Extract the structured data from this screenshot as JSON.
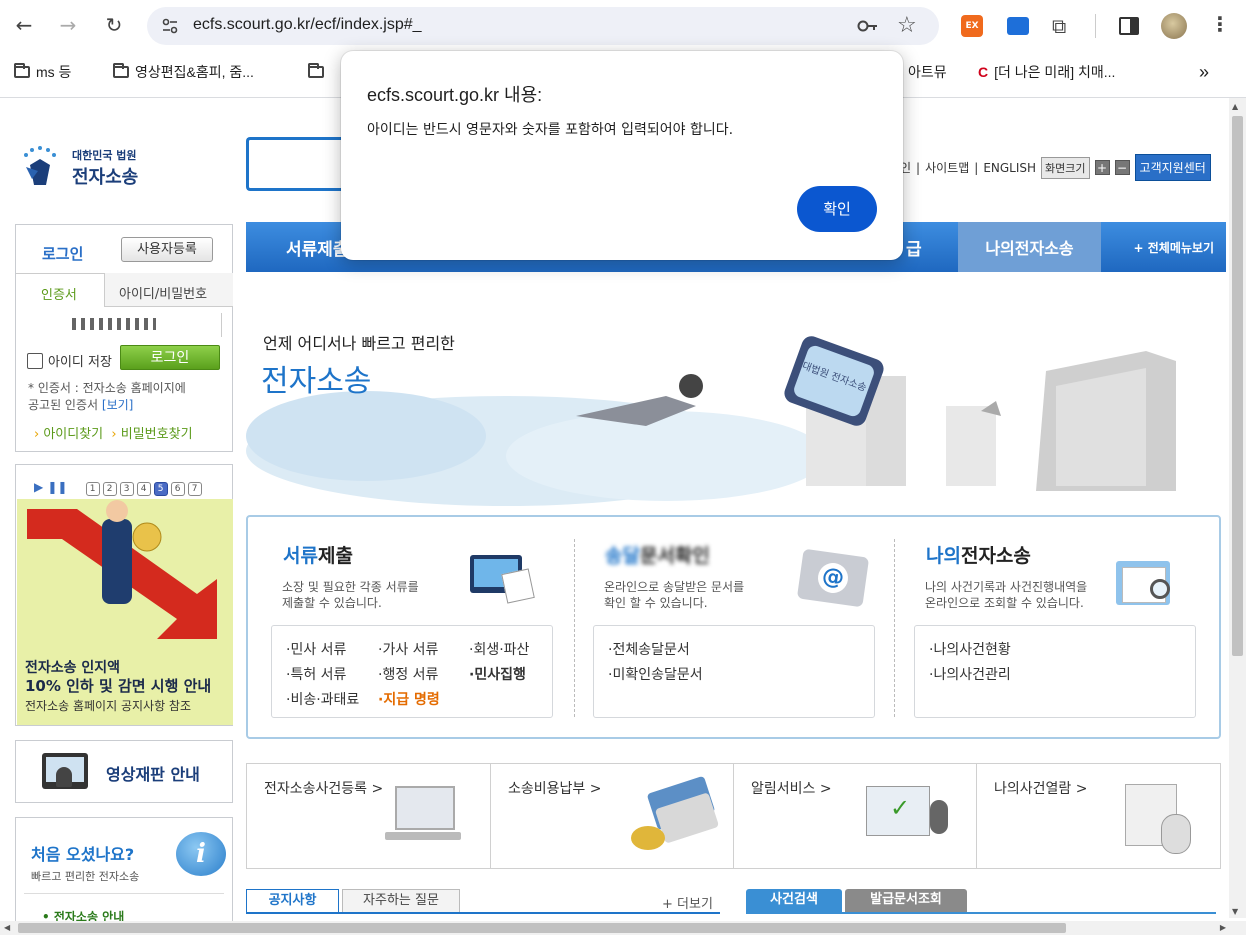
{
  "browser": {
    "url": "ecfs.scourt.go.kr/ecf/index.jsp#_",
    "bookmarks": [
      "ms 등",
      "영상편집&홈피, 줌...",
      "아트뮤",
      "[더 나은 미래] 치매..."
    ],
    "ext_label": "EX",
    "more": "»"
  },
  "dialog": {
    "title": "ecfs.scourt.go.kr 내용:",
    "message": "아이디는 반드시 영문자와 숫자를 포함하여 입력되어야 합니다.",
    "ok": "확인"
  },
  "logo": {
    "line1": "대한민국 법원",
    "line2": "전자소송"
  },
  "top_links": {
    "prefix": "인",
    "sitemap": "사이트맵",
    "english": "ENGLISH",
    "zoom": "화면크기",
    "plus": "+",
    "minus": "−",
    "support": "고객지원센터",
    "sep": "|"
  },
  "nav": {
    "first": "서류제출",
    "issue": "급",
    "mine": "나의전자소송",
    "all": "+ 전체메뉴보기"
  },
  "login": {
    "title": "로그인",
    "register": "사용자등록",
    "tab_cert": "인증서",
    "tab_id": "아이디/비밀번호",
    "save_id": "아이디 저장",
    "login_btn": "로그인",
    "note_bullet": "*",
    "note1": "인증서 : 전자소송 홈페이지에",
    "note2": "공고된 인증서",
    "note_link": "[보기]",
    "find_id": "아이디찾기",
    "find_pw": "비밀번호찾기"
  },
  "promo": {
    "pages": [
      "1",
      "2",
      "3",
      "4",
      "5",
      "6",
      "7"
    ],
    "active_page": "5",
    "line1": "전자소송 인지액",
    "line2": "10% 인하 및 감면 시행 안내",
    "line3": "전자소송 홈페이지 공지사항 참조"
  },
  "video": {
    "label": "영상재판 안내"
  },
  "first_visit": {
    "title": "처음 오셨나요?",
    "sub": "빠르고 편리한 전자소송",
    "item": "• 전자소송 안내"
  },
  "hero": {
    "tagline": "언제 어디서나 빠르고 편리한",
    "title": "전자소송",
    "sign": "대법원 전자소송"
  },
  "services": [
    {
      "title_accent": "서류",
      "title_rest": "제출",
      "desc1": "소장 및 필요한 각종 서류를",
      "desc2": "제출할 수 있습니다."
    },
    {
      "title_accent": "송달",
      "title_rest": "문서확인",
      "desc1": "온라인으로 송달받은 문서를",
      "desc2": "확인 할 수 있습니다."
    },
    {
      "title_accent": "나의",
      "title_rest": "전자소송",
      "desc1": "나의 사건기록과 사건진행내역을",
      "desc2": "온라인으로 조회할 수 있습니다."
    }
  ],
  "doc_list": [
    "·민사 서류",
    "·가사 서류",
    "·회생·파산",
    "·특허 서류",
    "·행정 서류",
    "·민사집행",
    "·비송·과태료",
    "·지급 명령"
  ],
  "delivery_list": [
    "·전체송달문서",
    "·미확인송달문서"
  ],
  "mycase_list": [
    "·나의사건현황",
    "·나의사건관리"
  ],
  "quick": [
    "전자소송사건등록 >",
    "소송비용납부 >",
    "알림서비스 >",
    "나의사건열람 >"
  ],
  "bottom_tabs": {
    "notice": "공지사항",
    "faq": "자주하는 질문",
    "more": "+ 더보기",
    "search": "사건검색",
    "issued": "발급문서조회"
  },
  "colors": {
    "accent_blue": "#1e74c9",
    "dialog_button": "#0b57d0",
    "green": "#5b9a1a",
    "orange": "#e46b00"
  }
}
